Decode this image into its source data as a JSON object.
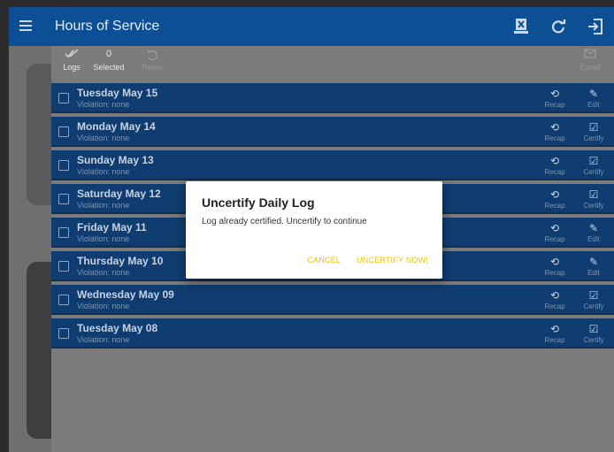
{
  "app": {
    "title": "Hours of Service",
    "header_icons": [
      "device-icon",
      "refresh-icon",
      "logout-icon"
    ]
  },
  "toolbar": {
    "logs_label": "Logs",
    "selected_count": "0",
    "selected_label": "Selected",
    "reset_label": "Reset",
    "email_label": "Email"
  },
  "logs": [
    {
      "date": "Tuesday May 15",
      "violation": "Violation: none",
      "recap": "Recap",
      "action": "Edit"
    },
    {
      "date": "Monday May 14",
      "violation": "Violation: none",
      "recap": "Recap",
      "action": "Certify"
    },
    {
      "date": "Sunday May 13",
      "violation": "Violation: none",
      "recap": "Recap",
      "action": "Certify"
    },
    {
      "date": "Saturday May 12",
      "violation": "Violation: none",
      "recap": "Recap",
      "action": "Certify"
    },
    {
      "date": "Friday May 11",
      "violation": "Violation: none",
      "recap": "Recap",
      "action": "Edit"
    },
    {
      "date": "Thursday May 10",
      "violation": "Violation: none",
      "recap": "Recap",
      "action": "Edit"
    },
    {
      "date": "Wednesday May 09",
      "violation": "Violation: none",
      "recap": "Recap",
      "action": "Certify"
    },
    {
      "date": "Tuesday May 08",
      "violation": "Violation: none",
      "recap": "Recap",
      "action": "Certify"
    }
  ],
  "dialog": {
    "title": "Uncertify Daily Log",
    "message": "Log already certified. Uncertify to continue",
    "cancel_label": "CANCEL",
    "confirm_label": "UNCERTIFY NOW!"
  },
  "colors": {
    "appbar": "#0d4f95",
    "row": "#103d71",
    "dialog_button": "#f2c200"
  }
}
